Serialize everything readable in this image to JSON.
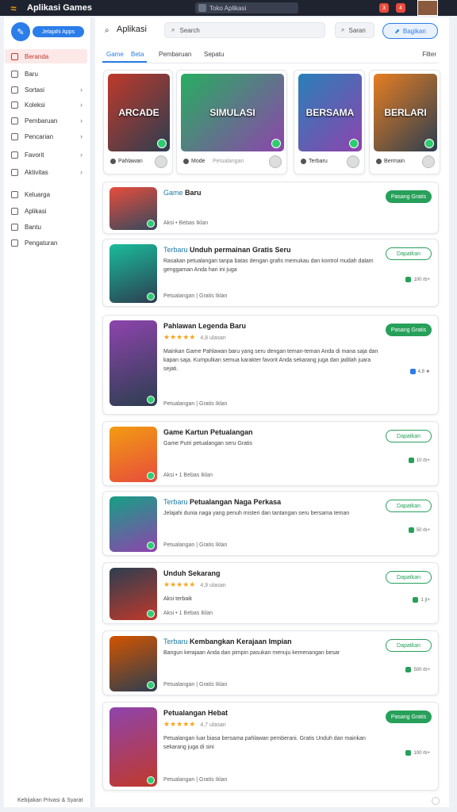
{
  "window": {
    "title": "Aplikasi Games",
    "url": "Toko Aplikasi",
    "logo_glyph": "≈",
    "tabs_badges": [
      "3",
      "4"
    ]
  },
  "sidebar": {
    "compose_icon": "edit-icon",
    "button_label": "Jelajahi Apps",
    "items": [
      {
        "label": "Beranda",
        "icon": "home-icon",
        "active": true,
        "chevron": false
      },
      {
        "label": "Baru",
        "icon": "new-icon",
        "active": false,
        "chevron": false
      },
      {
        "label": "Sortasi",
        "icon": "sort-icon",
        "active": false,
        "chevron": true
      },
      {
        "label": "Koleksi",
        "icon": "collection-icon",
        "active": false,
        "chevron": true
      },
      {
        "label": "Pembaruan",
        "icon": "update-icon",
        "active": false,
        "chevron": true
      },
      {
        "label": "Pencarian",
        "icon": "search-icon",
        "active": false,
        "chevron": true
      },
      {
        "label": "Favorit",
        "icon": "favorite-icon",
        "active": false,
        "chevron": true
      },
      {
        "label": "Aktivitas",
        "icon": "activity-icon",
        "active": false,
        "chevron": true
      },
      {
        "label": "Keluarga",
        "icon": "family-icon",
        "active": false,
        "chevron": false
      },
      {
        "label": "Aplikasi",
        "icon": "apps-icon",
        "active": false,
        "chevron": false
      },
      {
        "label": "Bantu",
        "icon": "help-icon",
        "active": false,
        "chevron": false
      },
      {
        "label": "Pengaturan",
        "icon": "settings-icon",
        "active": false,
        "chevron": false
      }
    ],
    "footer": "Kebijakan Privasi & Syarat"
  },
  "header": {
    "title": "Aplikasi",
    "search_placeholder": "Search",
    "search2_label": "Saran",
    "action_button": "Bagikan",
    "tabs": [
      "Game",
      "Beta",
      "Pembaruan",
      "Sepatu"
    ],
    "right_label": "Filter"
  },
  "featured": [
    {
      "art_text": "ARCADE",
      "name": "Pahlawan",
      "sub": "",
      "colors": [
        "#c0392b",
        "#2c3e50"
      ]
    },
    {
      "art_text": "SIMULASI",
      "name": "Mode",
      "sub": "Petualangan",
      "colors": [
        "#27ae60",
        "#8e44ad"
      ]
    },
    {
      "art_text": "BERSAMA",
      "name": "Terbaru",
      "sub": "",
      "colors": [
        "#2980b9",
        "#8e44ad"
      ]
    },
    {
      "art_text": "BERLARI",
      "name": "Bermain",
      "sub": "",
      "colors": [
        "#e67e22",
        "#2c3e50"
      ]
    }
  ],
  "apps": [
    {
      "pre": "Game",
      "title": "Baru",
      "stars": "",
      "rating": "",
      "desc": "",
      "meta": "Aksi • Bebas Iklan",
      "button": "Pasang Gratis",
      "btn_style": "filled",
      "small": "",
      "colors": [
        "#e74c3c",
        "#34495e"
      ]
    },
    {
      "pre": "Terbaru",
      "title": "Unduh permainan Gratis Seru",
      "stars": "",
      "rating": "",
      "desc": "Rasakan petualangan tanpa batas dengan grafis memukau dan kontrol mudah dalam genggaman Anda hari ini juga",
      "meta": "Petualangan  |  Gratis Iklan",
      "button": "Dapatkan",
      "btn_style": "outline",
      "small": "100 rb+",
      "colors": [
        "#1abc9c",
        "#2c3e50"
      ]
    },
    {
      "pre": "",
      "title": "Pahlawan Legenda Baru",
      "stars": "★★★★★",
      "rating": "4,8 ulasan",
      "desc": "Mainkan Game  Pahlawan baru yang seru dengan teman-teman Anda di mana saja dan kapan saja. Kumpulkan semua karakter favorit Anda sekarang juga dan jadilah juara sejati.",
      "meta": "Petualangan  |  Gratis Iklan",
      "button": "Pasang Gratis",
      "btn_style": "filled",
      "small": "4,8 ★",
      "colors": [
        "#8e44ad",
        "#2c3e50"
      ]
    },
    {
      "pre": "",
      "title": "Game Kartun Petualangan",
      "stars": "",
      "rating": "",
      "desc": "Game Putri petualangan seru Gratis",
      "meta": "Aksi • 1 Bebas Iklan",
      "button": "Dapatkan",
      "btn_style": "outline",
      "small": "10 rb+",
      "colors": [
        "#f39c12",
        "#e74c3c"
      ]
    },
    {
      "pre": "Terbaru",
      "title": "Petualangan Naga Perkasa",
      "stars": "",
      "rating": "",
      "desc": "Jelajahi dunia naga yang penuh misteri dan tantangan seru bersama teman",
      "meta": "Petualangan  |  Gratis Iklan",
      "button": "Dapatkan",
      "btn_style": "outline",
      "small": "50 rb+",
      "colors": [
        "#16a085",
        "#8e44ad"
      ]
    },
    {
      "pre": "",
      "title": "Unduh Sekarang",
      "stars": "★★★★★",
      "rating": "4,9 ulasan",
      "desc": "Aksi terbaik",
      "meta": "Aksi • 1 Bebas Iklan",
      "button": "Dapatkan",
      "btn_style": "outline",
      "small": "1 jt+",
      "colors": [
        "#2c3e50",
        "#c0392b"
      ]
    },
    {
      "pre": "Terbaru",
      "title": "Kembangkan Kerajaan Impian",
      "stars": "",
      "rating": "",
      "desc": "Bangun kerajaan Anda dan pimpin pasukan menuju kemenangan besar",
      "meta": "Petualangan  |  Gratis Iklan",
      "button": "Dapatkan",
      "btn_style": "outline",
      "small": "500 rb+",
      "colors": [
        "#d35400",
        "#2c3e50"
      ]
    },
    {
      "pre": "",
      "title": "Petualangan Hebat",
      "stars": "★★★★★",
      "rating": "4,7 ulasan",
      "desc": "Petualangan luar biasa bersama pahlawan pemberani. Gratis Unduh dan mainkan sekarang juga di sini",
      "meta": "Petualangan  |  Gratis Iklan",
      "button": "Pasang Gratis",
      "btn_style": "filled",
      "small": "100 rb+",
      "colors": [
        "#8e44ad",
        "#c0392b"
      ]
    }
  ]
}
